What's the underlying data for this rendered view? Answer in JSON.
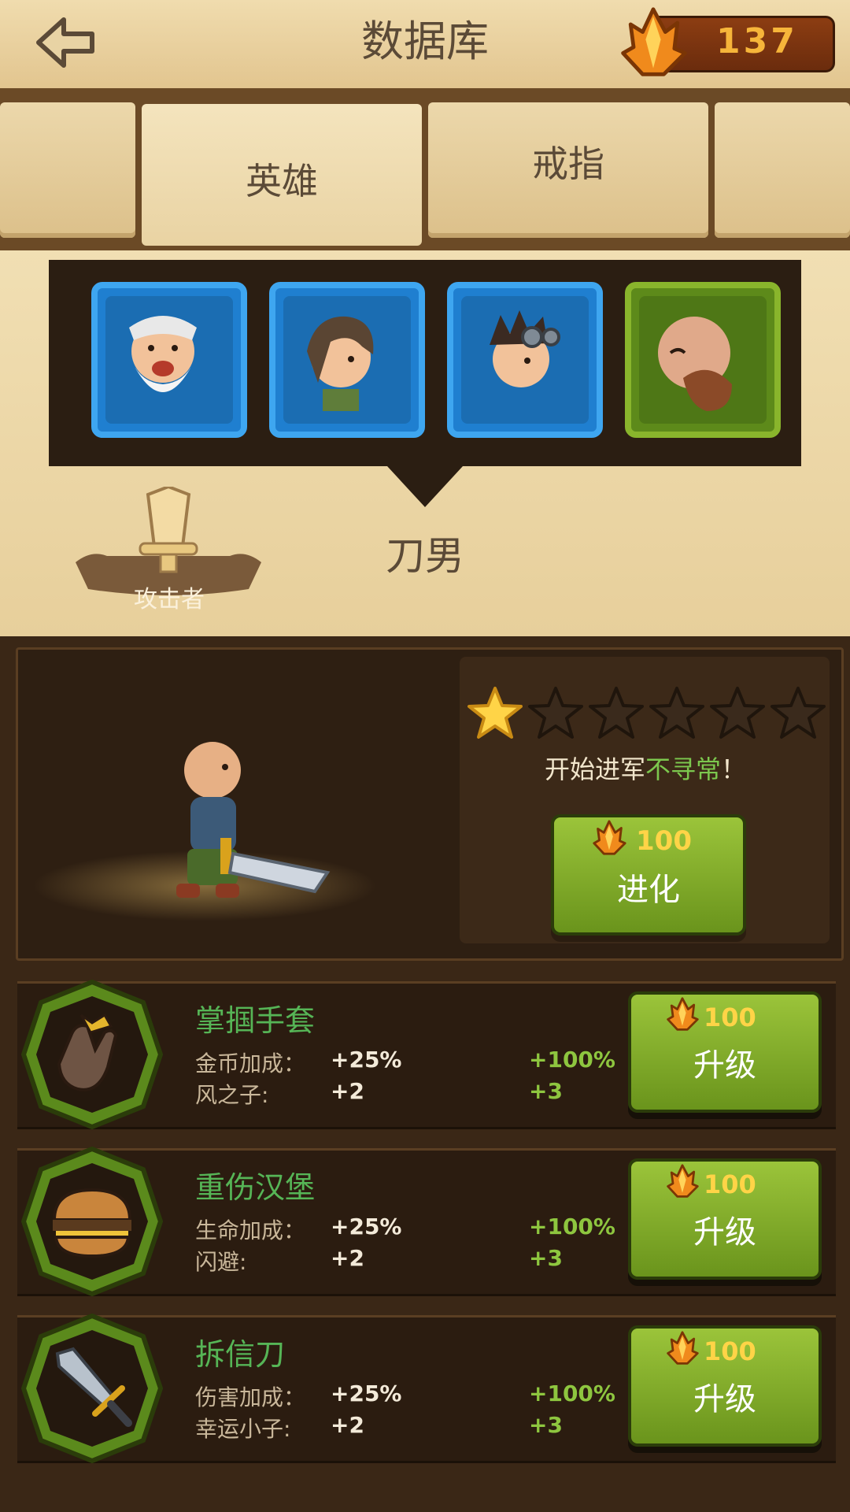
{
  "header": {
    "title": "数据库",
    "crystals": "137"
  },
  "tabs": [
    {
      "label": ""
    },
    {
      "label": "英雄",
      "active": true
    },
    {
      "label": "戒指"
    },
    {
      "label": ""
    }
  ],
  "heroes": [
    {
      "name": "old-bearded-hero-portrait",
      "frame": "blue"
    },
    {
      "name": "girl-hero-portrait",
      "frame": "blue"
    },
    {
      "name": "goggles-hero-portrait",
      "frame": "blue"
    },
    {
      "name": "mustache-hero-portrait",
      "frame": "green"
    }
  ],
  "selected_hero": {
    "role": "攻击者",
    "name": "刀男",
    "stars_filled": 1,
    "stars_total": 6,
    "message_prefix": "开始进军",
    "message_highlight": "不寻常",
    "message_suffix": "！",
    "evolve_cost": "100",
    "evolve_label": "进化"
  },
  "items": [
    {
      "name": "掌掴手套",
      "icon": "glove-icon",
      "stats": [
        {
          "label": "金币加成：",
          "current": "+25%",
          "next": "+100%"
        },
        {
          "label": "风之子:",
          "current": "+2",
          "next": "+3"
        }
      ],
      "cost": "100",
      "button": "升级"
    },
    {
      "name": "重伤汉堡",
      "icon": "burger-icon",
      "stats": [
        {
          "label": "生命加成：",
          "current": "+25%",
          "next": "+100%"
        },
        {
          "label": "闪避:",
          "current": "+2",
          "next": "+3"
        }
      ],
      "cost": "100",
      "button": "升级"
    },
    {
      "name": "拆信刀",
      "icon": "sword-icon",
      "stats": [
        {
          "label": "伤害加成：",
          "current": "+25%",
          "next": "+100%"
        },
        {
          "label": "幸运小子:",
          "current": "+2",
          "next": "+3"
        }
      ],
      "cost": "100",
      "button": "升级"
    }
  ],
  "colors": {
    "accent_green": "#8ec63f",
    "item_name_green": "#56b556",
    "crystal_orange": "#f6b53a",
    "parchment": "#ecd8ab"
  }
}
